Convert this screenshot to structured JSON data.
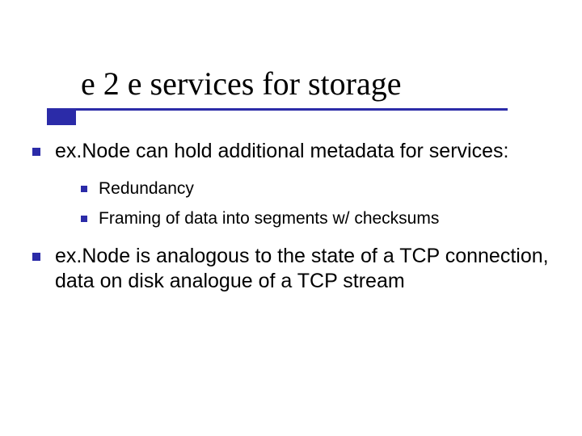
{
  "title": "e 2 e services for storage",
  "bullets": {
    "b1": "ex.Node can hold additional metadata for services:",
    "b1a": "Redundancy",
    "b1b": "Framing of data into segments w/ checksums",
    "b2": "ex.Node is analogous to the state of a TCP connection, data on disk analogue of a TCP stream"
  },
  "colors": {
    "accent": "#2b2ba8",
    "text": "#000000",
    "background": "#ffffff"
  }
}
